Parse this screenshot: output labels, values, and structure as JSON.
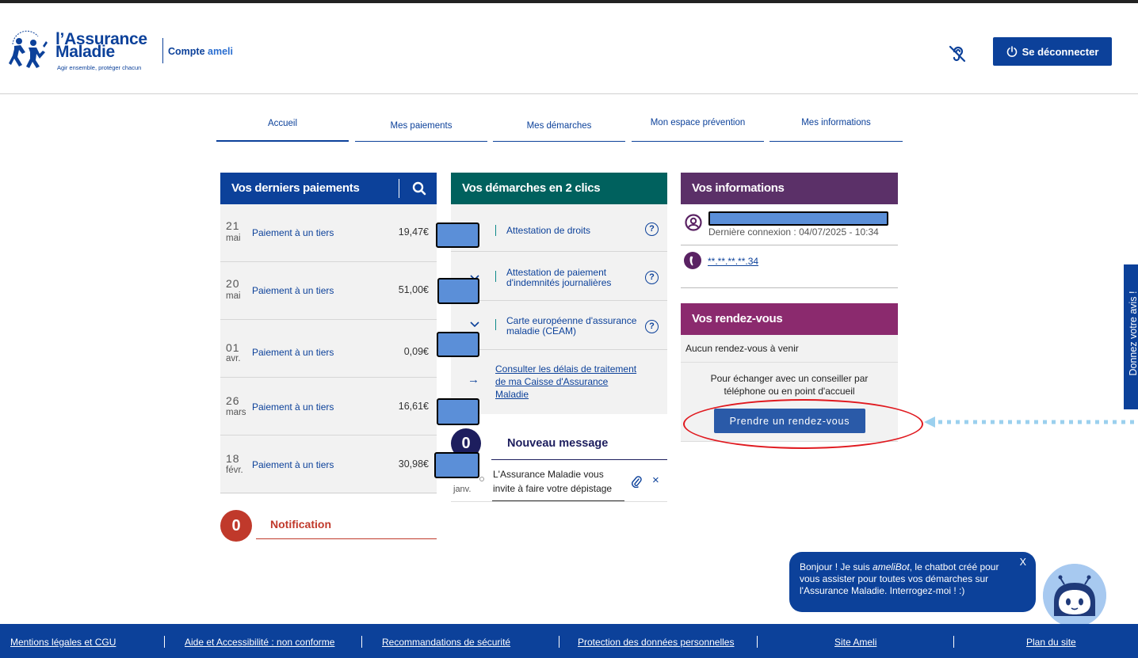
{
  "header": {
    "logo_line1": "l’Assurance",
    "logo_line2": "Maladie",
    "logo_tagline": "Agir ensemble, protéger chacun",
    "compte_part1": "Compte ",
    "compte_part2": "ameli",
    "hearing_icon": "hearing-impaired-icon",
    "logout_label": "Se déconnecter",
    "logout_icon": "power-icon"
  },
  "nav": {
    "tabs": [
      {
        "label": "Accueil",
        "active": true
      },
      {
        "label": "Mes paiements",
        "active": false
      },
      {
        "label": "Mes démarches",
        "active": false
      },
      {
        "label": "Mon espace prévention",
        "active": false
      },
      {
        "label": "Mes informations",
        "active": false
      }
    ]
  },
  "payments": {
    "title": "Vos derniers paiements",
    "search_icon": "search-icon",
    "header_color": "#0c419a",
    "rows": [
      {
        "day": "21",
        "month": "mai",
        "label": "Paiement à un tiers",
        "amount": "19,47€"
      },
      {
        "day": "20",
        "month": "mai",
        "label": "Paiement à un tiers",
        "amount": "51,00€"
      },
      {
        "day": "01",
        "month": "avr.",
        "label": "Paiement à un tiers",
        "amount": "0,09€"
      },
      {
        "day": "26",
        "month": "mars",
        "label": "Paiement à un tiers",
        "amount": "16,61€"
      },
      {
        "day": "18",
        "month": "févr.",
        "label": "Paiement à un tiers",
        "amount": "30,98€"
      }
    ]
  },
  "notification": {
    "count": "0",
    "label": "Notification",
    "color": "#c0392b"
  },
  "demarches": {
    "title": "Vos démarches en 2 clics",
    "header_color": "#00615e",
    "items": [
      {
        "label": "Attestation de droits"
      },
      {
        "label_line1": "Attestation de paiement",
        "label_line2": "d'indemnités journalières"
      },
      {
        "label_line1": "Carte européenne d'assurance",
        "label_line2": "maladie (CEAM)"
      }
    ],
    "consult_line1": "Consulter les délais de traitement",
    "consult_line2": "de ma Caisse d'Assurance",
    "consult_line3": "Maladie"
  },
  "messages": {
    "count": "0",
    "title": "Nouveau message",
    "date": "janv.",
    "text_line1": "L'Assurance Maladie vous",
    "text_line2": "invite à faire votre dépistage",
    "clip_icon": "paperclip-icon",
    "delete_label": "×"
  },
  "informations": {
    "title": "Vos informations",
    "header_color": "#5b3068",
    "last_login": "Dernière connexion : 04/07/2025 - 10:34",
    "phone": "**.**.**.**.34"
  },
  "rendezvous": {
    "title": "Vos rendez-vous",
    "header_color": "#8b2a6e",
    "none_text": "Aucun rendez-vous à venir",
    "info_line1": "Pour échanger avec un conseiller par",
    "info_line2": "téléphone ou en point d'accueil",
    "button_label": "Prendre un rendez-vous"
  },
  "feedback": {
    "label": "Donnez votre avis !"
  },
  "chatbot": {
    "text_before": "Bonjour ! Je suis ",
    "bot_name": "ameliBot",
    "text_after": ", le chatbot créé pour vous assister pour toutes vos démarches sur l'Assurance Maladie. Interrogez-moi ! :)",
    "close_label": "X"
  },
  "footer": {
    "links": [
      "Mentions légales et CGU",
      "Aide et Accessibilité : non conforme",
      "Recommandations de sécurité",
      "Protection des données personnelles",
      "Site Ameli",
      "Plan du site"
    ]
  }
}
